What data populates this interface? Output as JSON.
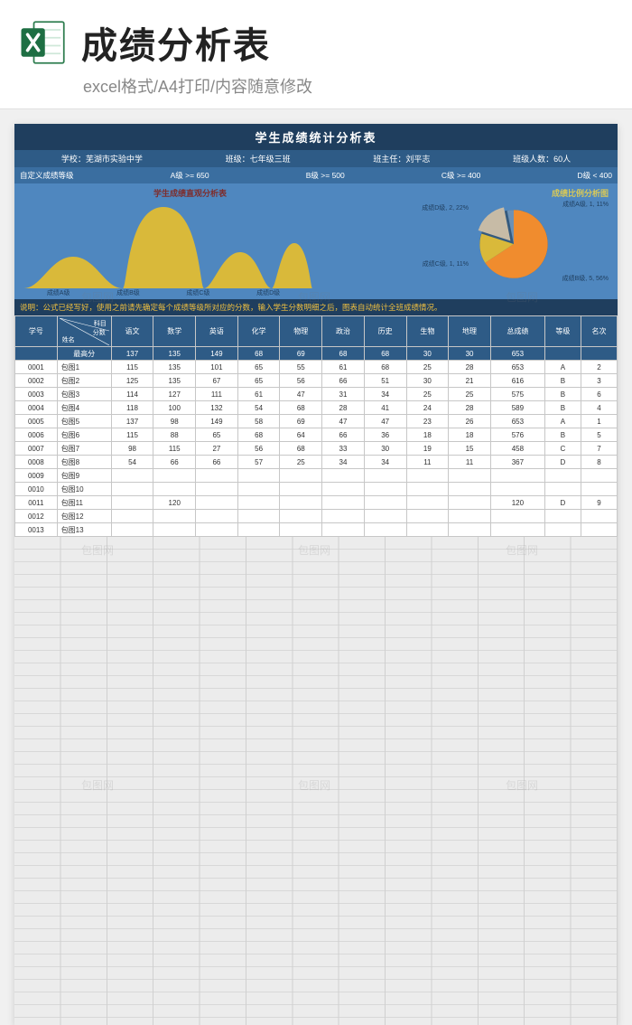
{
  "banner": {
    "title": "成绩分析表",
    "subtitle": "excel格式/A4打印/内容随意修改"
  },
  "sheet": {
    "title": "学生成绩统计分析表",
    "info": {
      "school_label": "学校：",
      "school": "芜湖市实验中学",
      "class_label": "班级：",
      "class": "七年级三班",
      "teacher_label": "班主任：",
      "teacher": "刘平志",
      "size_label": "班级人数：",
      "size": "60人"
    },
    "grade_levels": {
      "label": "自定义成绩等级",
      "a": "A级 >= 650",
      "b": "B级 >= 500",
      "c": "C级 >= 400",
      "d": "D级 < 400"
    },
    "chart_titles": {
      "area": "学生成绩直观分析表",
      "pie": "成绩比例分析图"
    },
    "pie_labels": {
      "a": "成绩A级, 1, 11%",
      "b": "成绩B级, 5, 56%",
      "c": "成绩C级, 1, 11%",
      "d": "成绩D级, 2, 22%"
    },
    "area_labels": [
      "成绩A级",
      "成绩B级",
      "成绩C级",
      "成绩D级"
    ],
    "note_prefix": "说明：",
    "note": "公式已经写好，使用之前请先确定每个成绩等级所对应的分数，输入学生分数明细之后，图表自动统计全班成绩情况。",
    "headers": {
      "corner_top": "科目",
      "corner_mid": "分数",
      "corner_bottom": "姓名",
      "id": "学号",
      "cols": [
        "语文",
        "数学",
        "英语",
        "化学",
        "物理",
        "政治",
        "历史",
        "生物",
        "地理",
        "总成绩",
        "等级",
        "名次"
      ]
    },
    "max_label": "最高分",
    "max_row": [
      "137",
      "135",
      "149",
      "68",
      "69",
      "68",
      "68",
      "30",
      "30",
      "653",
      "",
      ""
    ],
    "rows": [
      {
        "id": "0001",
        "name": "包图1",
        "v": [
          "115",
          "135",
          "101",
          "65",
          "55",
          "61",
          "68",
          "25",
          "28",
          "653",
          "A",
          "2"
        ]
      },
      {
        "id": "0002",
        "name": "包图2",
        "v": [
          "125",
          "135",
          "67",
          "65",
          "56",
          "66",
          "51",
          "30",
          "21",
          "616",
          "B",
          "3"
        ]
      },
      {
        "id": "0003",
        "name": "包图3",
        "v": [
          "114",
          "127",
          "111",
          "61",
          "47",
          "31",
          "34",
          "25",
          "25",
          "575",
          "B",
          "6"
        ]
      },
      {
        "id": "0004",
        "name": "包图4",
        "v": [
          "118",
          "100",
          "132",
          "54",
          "68",
          "28",
          "41",
          "24",
          "28",
          "589",
          "B",
          "4"
        ]
      },
      {
        "id": "0005",
        "name": "包图5",
        "v": [
          "137",
          "98",
          "149",
          "58",
          "69",
          "47",
          "47",
          "23",
          "26",
          "653",
          "A",
          "1"
        ]
      },
      {
        "id": "0006",
        "name": "包图6",
        "v": [
          "115",
          "88",
          "65",
          "68",
          "64",
          "66",
          "36",
          "18",
          "18",
          "576",
          "B",
          "5"
        ]
      },
      {
        "id": "0007",
        "name": "包图7",
        "v": [
          "98",
          "115",
          "27",
          "56",
          "68",
          "33",
          "30",
          "19",
          "15",
          "458",
          "C",
          "7"
        ]
      },
      {
        "id": "0008",
        "name": "包图8",
        "v": [
          "54",
          "66",
          "66",
          "57",
          "25",
          "34",
          "34",
          "11",
          "11",
          "367",
          "D",
          "8"
        ]
      },
      {
        "id": "0009",
        "name": "包图9",
        "v": [
          "",
          "",
          "",
          "",
          "",
          "",
          "",
          "",
          "",
          "",
          "",
          ""
        ]
      },
      {
        "id": "0010",
        "name": "包图10",
        "v": [
          "",
          "",
          "",
          "",
          "",
          "",
          "",
          "",
          "",
          "",
          "",
          ""
        ]
      },
      {
        "id": "0011",
        "name": "包图11",
        "v": [
          "",
          "120",
          "",
          "",
          "",
          "",
          "",
          "",
          "",
          "120",
          "D",
          "9"
        ]
      },
      {
        "id": "0012",
        "name": "包图12",
        "v": [
          "",
          "",
          "",
          "",
          "",
          "",
          "",
          "",
          "",
          "",
          "",
          ""
        ]
      },
      {
        "id": "0013",
        "name": "包图13",
        "v": [
          "",
          "",
          "",
          "",
          "",
          "",
          "",
          "",
          "",
          "",
          "",
          ""
        ]
      }
    ]
  },
  "chart_data": [
    {
      "type": "area",
      "title": "学生成绩直观分析表",
      "categories": [
        "成绩A级",
        "成绩B级",
        "成绩C级",
        "成绩D级"
      ],
      "values": [
        1,
        5,
        1,
        2
      ]
    },
    {
      "type": "pie",
      "title": "成绩比例分析图",
      "series": [
        {
          "name": "成绩A级",
          "value": 1,
          "pct": 11
        },
        {
          "name": "成绩B级",
          "value": 5,
          "pct": 56
        },
        {
          "name": "成绩C级",
          "value": 1,
          "pct": 11
        },
        {
          "name": "成绩D级",
          "value": 2,
          "pct": 22
        }
      ]
    }
  ],
  "watermark": "包图网"
}
